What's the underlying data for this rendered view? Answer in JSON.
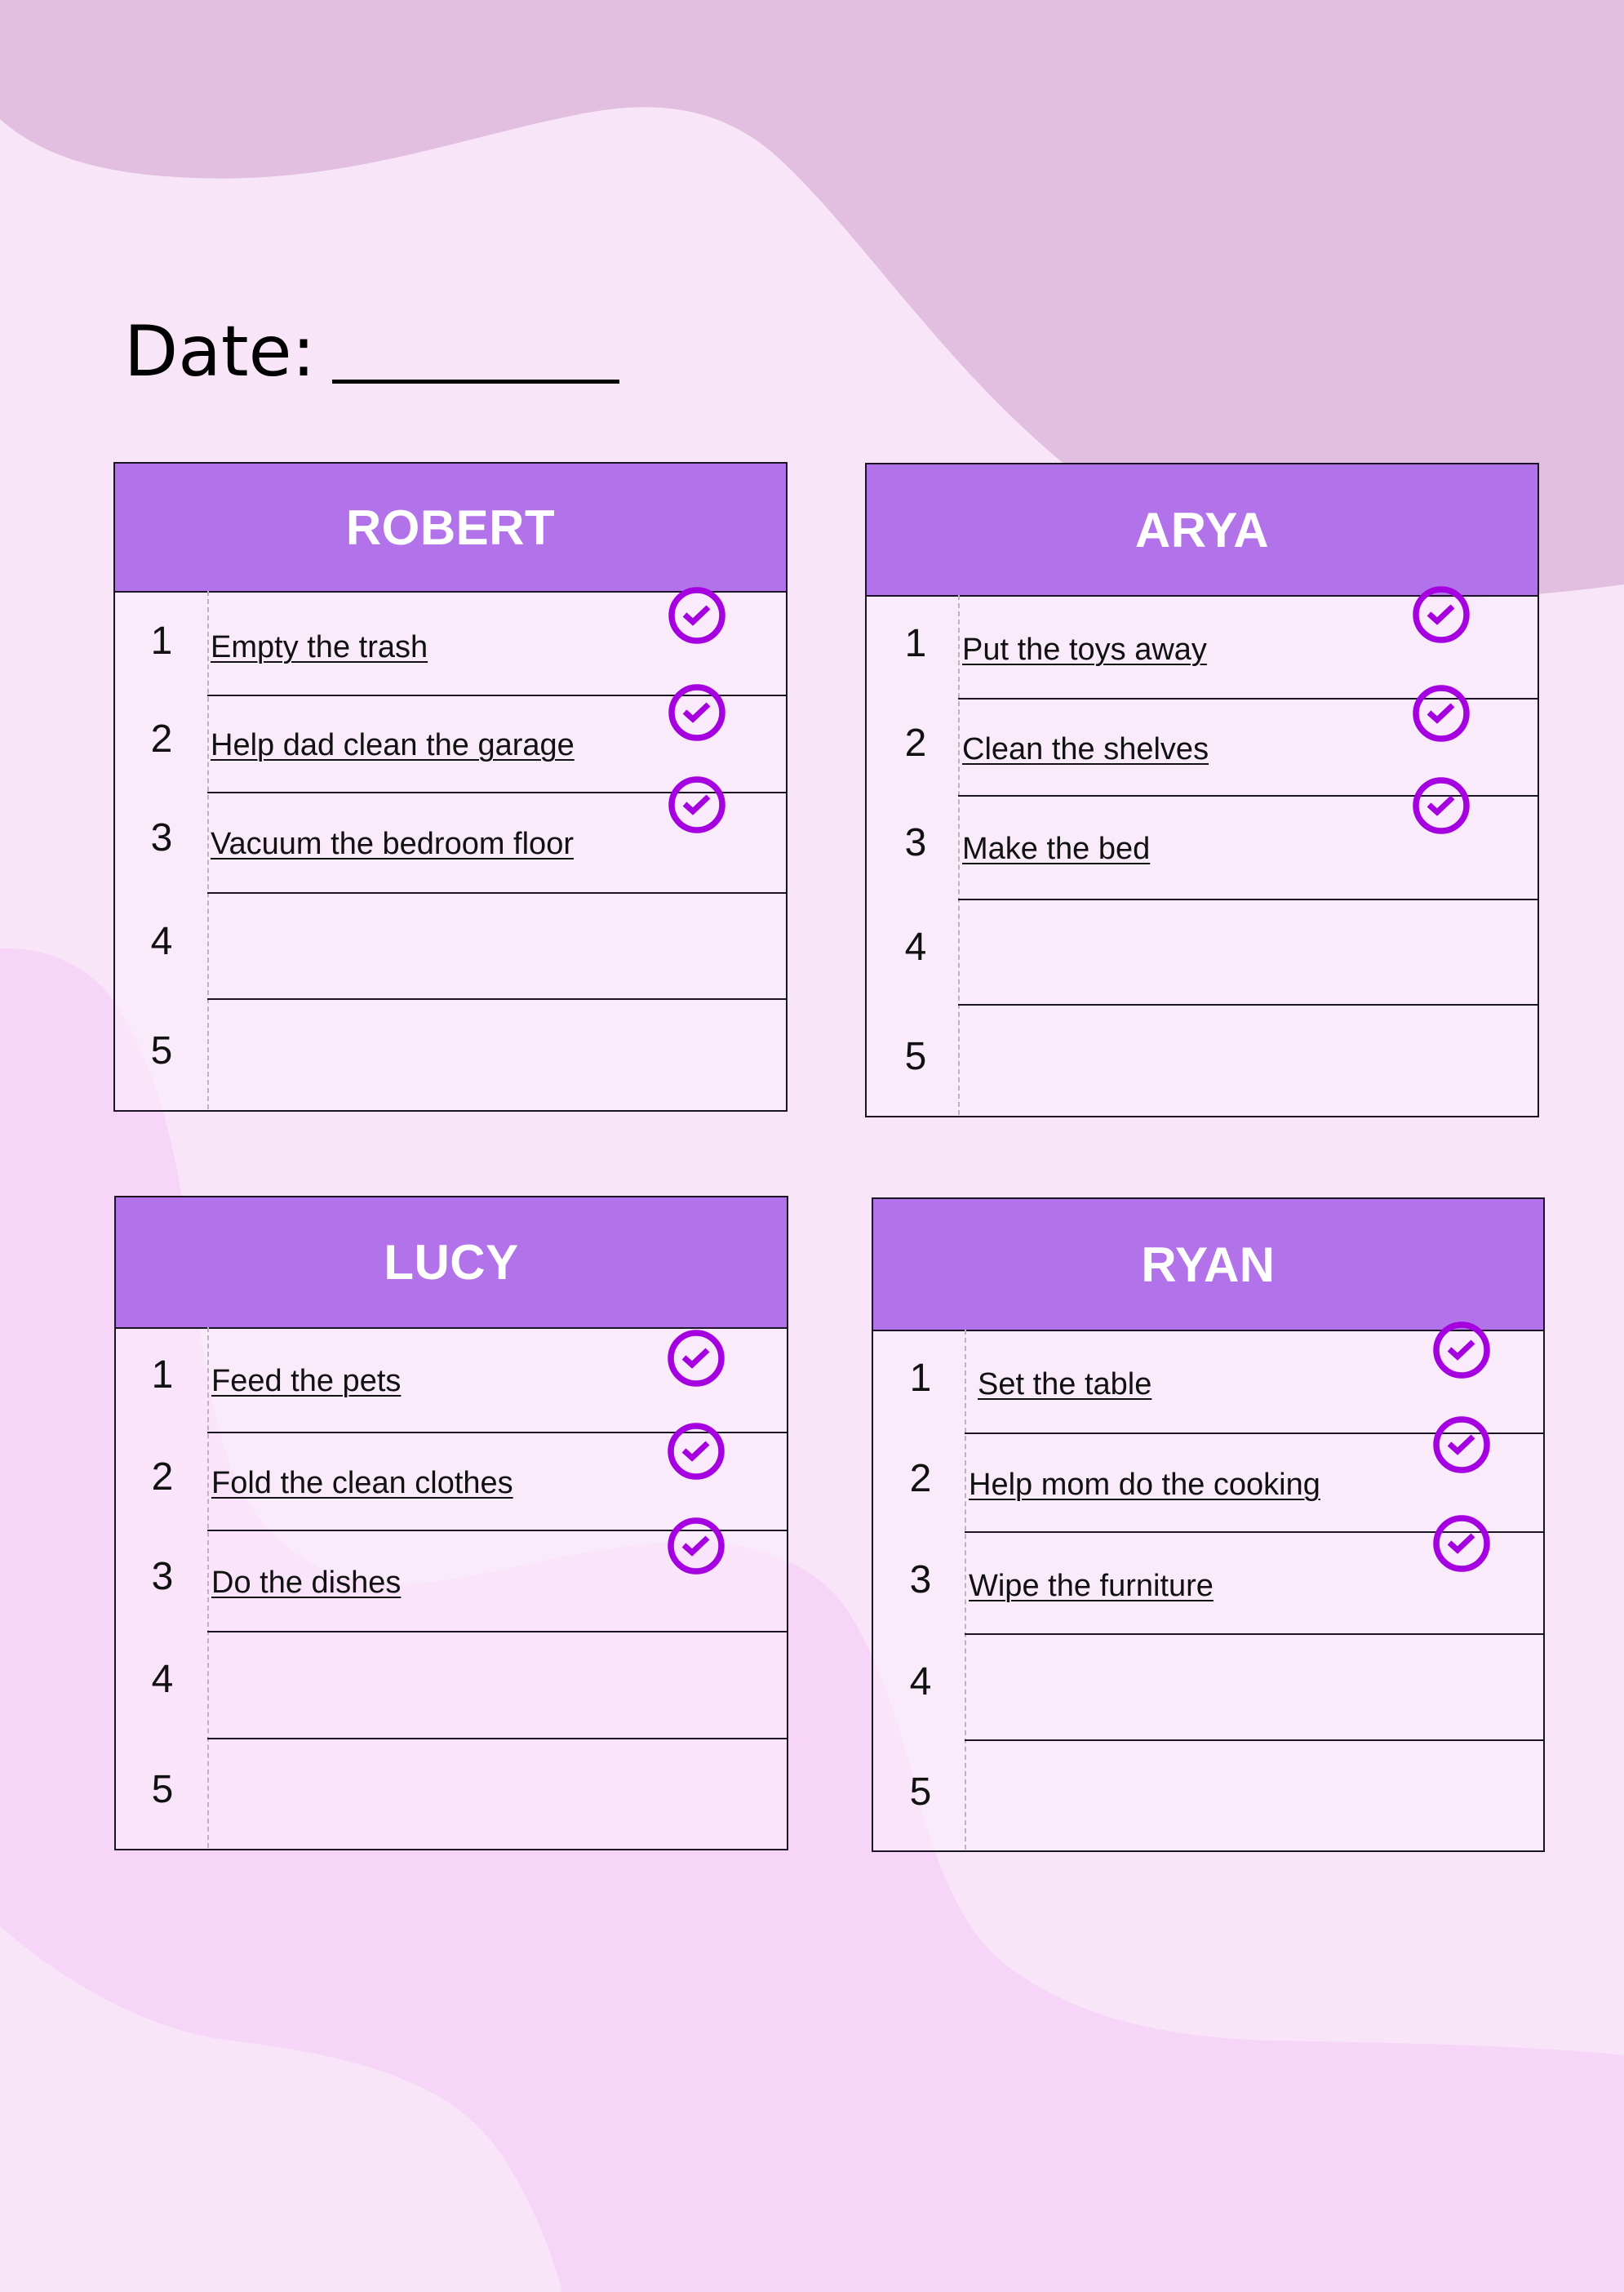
{
  "date": {
    "label": "Date:"
  },
  "colors": {
    "background": "#F8E6F8",
    "top_blob": "#E2BEE0",
    "bottom_blob": "#F6D5F8",
    "header": "#B273EA",
    "check": "#A500E0"
  },
  "cards": [
    {
      "name": "ROBERT",
      "rows": [
        {
          "number": "1",
          "task": "Empty the trash",
          "done": true
        },
        {
          "number": "2",
          "task": "Help dad clean the garage",
          "done": true
        },
        {
          "number": "3",
          "task": "Vacuum the bedroom floor",
          "done": true
        },
        {
          "number": "4",
          "task": "",
          "done": false
        },
        {
          "number": "5",
          "task": "",
          "done": false
        }
      ]
    },
    {
      "name": "ARYA",
      "rows": [
        {
          "number": "1",
          "task": "Put the toys away",
          "done": true
        },
        {
          "number": "2",
          "task": "Clean the shelves",
          "done": true
        },
        {
          "number": "3",
          "task": "Make the bed",
          "done": true
        },
        {
          "number": "4",
          "task": "",
          "done": false
        },
        {
          "number": "5",
          "task": "",
          "done": false
        }
      ]
    },
    {
      "name": "LUCY",
      "rows": [
        {
          "number": "1",
          "task": "Feed the pets",
          "done": true
        },
        {
          "number": "2",
          "task": "Fold the clean clothes",
          "done": true
        },
        {
          "number": "3",
          "task": "Do the dishes",
          "done": true
        },
        {
          "number": "4",
          "task": "",
          "done": false
        },
        {
          "number": "5",
          "task": "",
          "done": false
        }
      ]
    },
    {
      "name": "RYAN",
      "rows": [
        {
          "number": "1",
          "task": "Set the table",
          "done": true
        },
        {
          "number": "2",
          "task": "Help mom do the cooking",
          "done": true
        },
        {
          "number": "3",
          "task": "Wipe the furniture",
          "done": true
        },
        {
          "number": "4",
          "task": "",
          "done": false
        },
        {
          "number": "5",
          "task": "",
          "done": false
        }
      ]
    }
  ]
}
